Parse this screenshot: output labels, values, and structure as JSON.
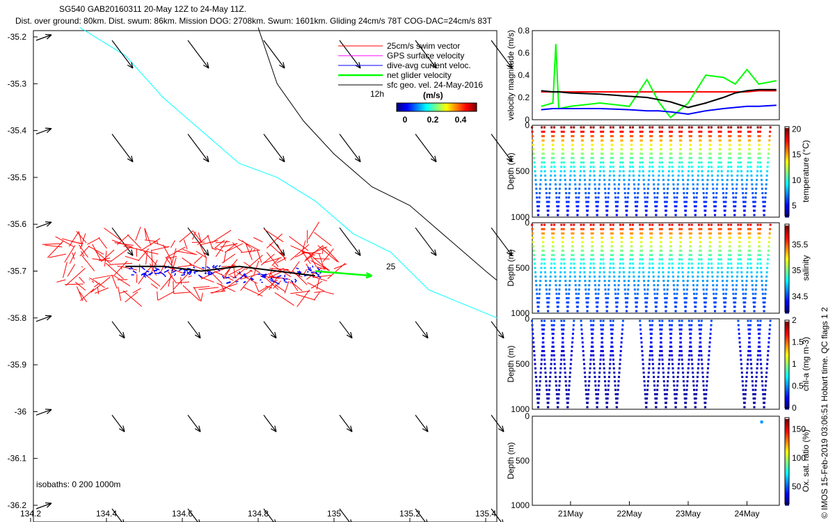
{
  "title": {
    "line1": "SG540 GAB20160311 20-May 12Z to 24-May 11Z.",
    "line2": "Dist. over ground: 80km. Dist. swum: 86km. Mission DOG: 2708km. Swum: 1601km. Gliding 24cm/s 78T COG-DAC=24cm/s 83T"
  },
  "credit": "© IMOS 15-Feb-2019 03:06:51 Hobart time. QC flags 1  2",
  "colors": {
    "swim": "#ff0000",
    "gps": "#ff00ff",
    "dac": "#0000ff",
    "net": "#00ff00",
    "sfc": "#000000",
    "isobath": "#00ffff"
  },
  "chart_data": [
    {
      "type": "scatter",
      "name": "map",
      "xlim": [
        134.2,
        135.43
      ],
      "ylim": [
        -36.2,
        -35.18
      ],
      "xticks": [
        "134.2",
        "134.4",
        "134.6",
        "134.8",
        "135",
        "135.2",
        "135.4"
      ],
      "xtick_values": [
        134.2,
        134.4,
        134.6,
        134.8,
        135,
        135.2,
        135.4
      ],
      "yticks": [
        "-35.2",
        "-35.3",
        "-35.4",
        "-35.5",
        "-35.6",
        "-35.7",
        "-35.8",
        "-35.9",
        "-36",
        "-36.1",
        "-36.2"
      ],
      "ytick_values": [
        -35.2,
        -35.3,
        -35.4,
        -35.5,
        -35.6,
        -35.7,
        -35.8,
        -35.9,
        -36,
        -36.1,
        -36.2
      ],
      "legend": [
        "25cm/s swim vector",
        "GPS surface velocity",
        "dive-avg current veloc.",
        "net glider velocity",
        "sfc geo. vel. 24-May-2016"
      ],
      "legend_12h": "12h",
      "colorbar_unit": "(m/s)",
      "colorbar_ticks": [
        "0",
        "0.2",
        "0.4"
      ],
      "net_label": "25",
      "isobaths_label": "isobaths: 0   200   1000m",
      "isobath_200": [
        [
          134.33,
          -35.18
        ],
        [
          134.45,
          -35.24
        ],
        [
          134.55,
          -35.33
        ],
        [
          134.65,
          -35.4
        ],
        [
          134.75,
          -35.47
        ],
        [
          134.85,
          -35.5
        ],
        [
          134.95,
          -35.55
        ],
        [
          135.05,
          -35.62
        ],
        [
          135.15,
          -35.66
        ],
        [
          135.25,
          -35.74
        ],
        [
          135.43,
          -35.8
        ]
      ],
      "isobath_1000": [
        [
          134.8,
          -35.18
        ],
        [
          134.85,
          -35.3
        ],
        [
          134.92,
          -35.38
        ],
        [
          135.0,
          -35.45
        ],
        [
          135.1,
          -35.52
        ],
        [
          135.2,
          -35.56
        ],
        [
          135.3,
          -35.63
        ],
        [
          135.4,
          -35.7
        ],
        [
          135.43,
          -35.72
        ]
      ],
      "track": [
        [
          134.45,
          -35.69
        ],
        [
          134.55,
          -35.69
        ],
        [
          134.65,
          -35.7
        ],
        [
          134.75,
          -35.69
        ],
        [
          134.85,
          -35.7
        ],
        [
          134.95,
          -35.71
        ]
      ],
      "net_vector": [
        [
          134.95,
          -35.7
        ],
        [
          135.1,
          -35.71
        ]
      ],
      "sfc_vectors_grid": {
        "lons": [
          134.2,
          134.4,
          134.6,
          134.8,
          135,
          135.2,
          135.4
        ],
        "lats": [
          -35.2,
          -35.4,
          -35.6,
          -35.8,
          -36,
          -36.2
        ]
      }
    },
    {
      "type": "line",
      "name": "velocity",
      "ylabel": "velocity magnitude (m/s)",
      "ylim": [
        0,
        0.8
      ],
      "yticks": [
        "0",
        "0.2",
        "0.4",
        "0.6",
        "0.8"
      ],
      "xticks": [
        "21May",
        "22May",
        "23May",
        "24May"
      ],
      "x": [
        20.5,
        20.7,
        20.75,
        20.8,
        21,
        21.5,
        22,
        22.3,
        22.5,
        22.7,
        23,
        23.3,
        23.6,
        23.8,
        24,
        24.2,
        24.5
      ],
      "series": [
        {
          "name": "swim",
          "values": [
            0.25,
            0.25,
            0.25,
            0.25,
            0.25,
            0.25,
            0.25,
            0.25,
            0.25,
            0.25,
            0.25,
            0.25,
            0.25,
            0.25,
            0.25,
            0.26,
            0.26
          ]
        },
        {
          "name": "net",
          "values": [
            0.12,
            0.15,
            0.68,
            0.1,
            0.12,
            0.15,
            0.12,
            0.36,
            0.16,
            0.02,
            0.15,
            0.4,
            0.38,
            0.32,
            0.45,
            0.32,
            0.35
          ]
        },
        {
          "name": "dac",
          "values": [
            0.09,
            0.1,
            0.1,
            0.1,
            0.1,
            0.1,
            0.09,
            0.08,
            0.08,
            0.07,
            0.05,
            0.08,
            0.1,
            0.11,
            0.12,
            0.12,
            0.13
          ]
        },
        {
          "name": "sfc",
          "values": [
            0.26,
            0.25,
            0.25,
            0.25,
            0.24,
            0.23,
            0.21,
            0.2,
            0.18,
            0.16,
            0.11,
            0.15,
            0.2,
            0.24,
            0.26,
            0.27,
            0.27
          ]
        }
      ]
    },
    {
      "type": "scatter",
      "name": "temperature",
      "ylabel": "Depth (m)",
      "cbar_label": "temperature (°C)",
      "yticks": [
        "0",
        "500",
        "1000"
      ],
      "cbar_ticks": [
        "5",
        "10",
        "15",
        "20"
      ],
      "crange": [
        3,
        20.5
      ],
      "dives": 24,
      "maxdepth": 1000,
      "surface": 20,
      "deep": 3.5
    },
    {
      "type": "scatter",
      "name": "salinity",
      "ylabel": "Depth (m)",
      "cbar_label": "salinity",
      "yticks": [
        "0",
        "500",
        "1000"
      ],
      "cbar_ticks": [
        "34.5",
        "35",
        "35.5"
      ],
      "crange": [
        34.2,
        35.9
      ],
      "dives": 24,
      "maxdepth": 1000,
      "surface": 35.7,
      "deep": 34.35
    },
    {
      "type": "scatter",
      "name": "chla",
      "ylabel": "Depth (m)",
      "cbar_label": "chl-a (mg m-3)",
      "yticks": [
        "0",
        "500",
        "1000"
      ],
      "cbar_ticks": [
        "0",
        "0.5",
        "1",
        "1.5",
        "2"
      ],
      "crange": [
        0,
        2
      ],
      "dives": 24,
      "maxdepth": 1000,
      "surface": 0.4,
      "deep": 0.02
    },
    {
      "type": "scatter",
      "name": "oxygen",
      "ylabel": "Depth (m)",
      "cbar_label": "Ox. sat. ratio (%)",
      "yticks": [
        "0",
        "500",
        "1000"
      ],
      "cbar_ticks": [
        "50",
        "100",
        "150"
      ],
      "crange": [
        20,
        170
      ],
      "points": [
        [
          24.25,
          65,
          60
        ]
      ]
    }
  ]
}
